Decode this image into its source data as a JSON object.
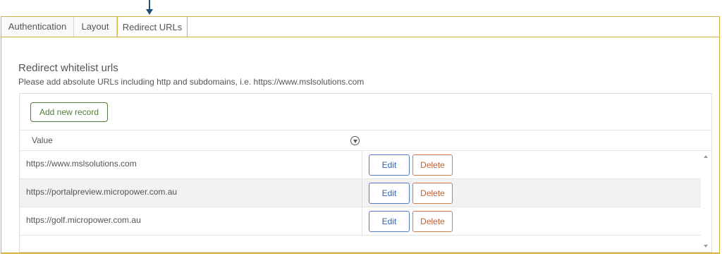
{
  "tabs": [
    {
      "label": "Authentication"
    },
    {
      "label": "Layout"
    },
    {
      "label": "Redirect URLs"
    }
  ],
  "section": {
    "heading": "Redirect whitelist urls",
    "subtext": "Please add absolute URLs including http and subdomains, i.e. https://www.mslsolutions.com"
  },
  "grid": {
    "add_label": "Add new record",
    "column_header": "Value",
    "rows": [
      {
        "value": "https://www.mslsolutions.com",
        "edit": "Edit",
        "delete": "Delete"
      },
      {
        "value": "https://portalpreview.micropower.com.au",
        "edit": "Edit",
        "delete": "Delete"
      },
      {
        "value": "https://golf.micropower.com.au",
        "edit": "Edit",
        "delete": "Delete"
      }
    ]
  },
  "colors": {
    "accent_gold": "#cfb34a",
    "add_green": "#4f7d35",
    "edit_blue": "#2f63b0",
    "delete_orange": "#c25a2a",
    "arrow": "#1f4e79"
  },
  "icons": {
    "pointer": "arrow-down-icon",
    "filter": "filter-icon"
  }
}
